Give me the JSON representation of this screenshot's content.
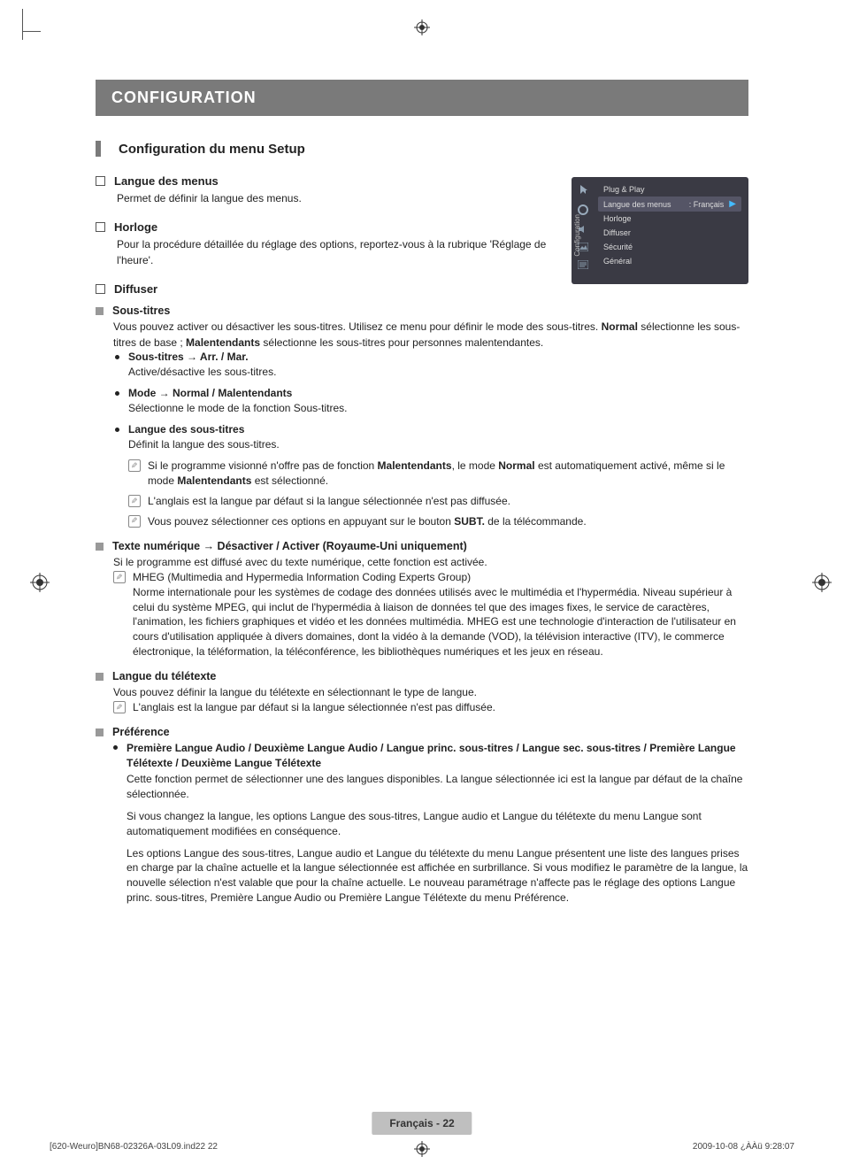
{
  "header": {
    "section": "CONFIGURATION",
    "subtitle": "Configuration du menu Setup"
  },
  "osd": {
    "side_label": "Configuration",
    "items": [
      {
        "label": "Plug & Play"
      },
      {
        "label": "Langue des menus",
        "value": ": Français",
        "selected": true
      },
      {
        "label": "Horloge"
      },
      {
        "label": "Diffuser"
      },
      {
        "label": "Sécurité"
      },
      {
        "label": "Général"
      }
    ]
  },
  "menu": {
    "langue": {
      "title": "Langue des menus",
      "desc": "Permet de définir la langue des menus."
    },
    "horloge": {
      "title": "Horloge",
      "desc": "Pour la procédure détaillée du réglage des options, reportez-vous à la rubrique 'Réglage de l'heure'."
    },
    "diffuser": {
      "title": "Diffuser"
    }
  },
  "sous_titres": {
    "heading": "Sous-titres",
    "intro_a": "Vous pouvez activer ou désactiver les sous-titres. Utilisez ce menu pour définir le mode des sous-titres. ",
    "intro_b": "Normal",
    "intro_c": " sélectionne les sous-titres de base ; ",
    "intro_d": "Malentendants",
    "intro_e": " sélectionne les sous-titres pour personnes malentendantes.",
    "b1_title": "Sous-titres → Arr. / Mar.",
    "b1_desc": "Active/désactive les sous-titres.",
    "b2_title": "Mode → Normal / Malentendants",
    "b2_desc": "Sélectionne le mode de la fonction Sous-titres.",
    "b3_title": "Langue des sous-titres",
    "b3_desc": "Définit la langue des sous-titres.",
    "n1a": "Si le programme visionné n'offre pas de fonction ",
    "n1b": "Malentendants",
    "n1c": ", le mode ",
    "n1d": "Normal",
    "n1e": " est automatiquement activé, même si le mode ",
    "n1f": "Malentendants",
    "n1g": " est sélectionné.",
    "n2": "L'anglais est la langue par défaut si la langue sélectionnée n'est pas diffusée.",
    "n3a": "Vous pouvez sélectionner ces options en appuyant sur le bouton ",
    "n3b": "SUBT.",
    "n3c": " de la télécommande."
  },
  "texte_num": {
    "heading": "Texte numérique → Désactiver / Activer (Royaume-Uni uniquement)",
    "desc": "Si le programme est diffusé avec du texte numérique, cette fonction est activée.",
    "n_head": "MHEG (Multimedia and Hypermedia Information Coding Experts Group)",
    "n_body": "Norme internationale pour les systèmes de codage des données utilisés avec le multimédia et l'hypermédia. Niveau supérieur à celui du système MPEG, qui inclut de l'hypermédia à liaison de données tel que des images fixes, le service de caractères, l'animation, les fichiers graphiques et vidéo et les données multimédia. MHEG est une technologie d'interaction de l'utilisateur en cours d'utilisation appliquée à divers domaines, dont la vidéo à la demande (VOD), la télévision interactive (ITV), le commerce électronique, la téléformation, la téléconférence, les bibliothèques numériques et les jeux en réseau."
  },
  "teletexte": {
    "heading": "Langue du télétexte",
    "desc": "Vous pouvez définir la langue du télétexte en sélectionnant le type de langue.",
    "note": "L'anglais est la langue par défaut si la langue sélectionnée n'est pas diffusée."
  },
  "pref": {
    "heading": "Préférence",
    "b_title": "Première Langue Audio / Deuxième Langue Audio / Langue princ. sous-titres / Langue sec. sous-titres / Première Langue Télétexte / Deuxième Langue Télétexte",
    "p1": "Cette fonction permet de sélectionner une des langues disponibles. La langue sélectionnée ici est la langue par défaut de la chaîne sélectionnée.",
    "p2": "Si vous changez la langue, les options Langue des sous-titres, Langue audio et Langue du télétexte du menu Langue sont automatiquement modifiées en conséquence.",
    "p3": "Les options Langue des sous-titres, Langue audio et Langue du télétexte du menu Langue présentent une liste des langues prises en charge par la chaîne actuelle et la langue sélectionnée est affichée en surbrillance. Si vous modifiez le paramètre de la langue, la nouvelle sélection n'est valable que pour la chaîne actuelle. Le nouveau paramétrage n'affecte pas le réglage des options Langue princ. sous-titres, Première Langue Audio ou Première Langue Télétexte du menu Préférence."
  },
  "footer": {
    "lang_page": "Français - 22",
    "left": "[620-Weuro]BN68-02326A-03L09.ind22   22",
    "right": "2009-10-08   ¿ÀÀü 9:28:07"
  }
}
